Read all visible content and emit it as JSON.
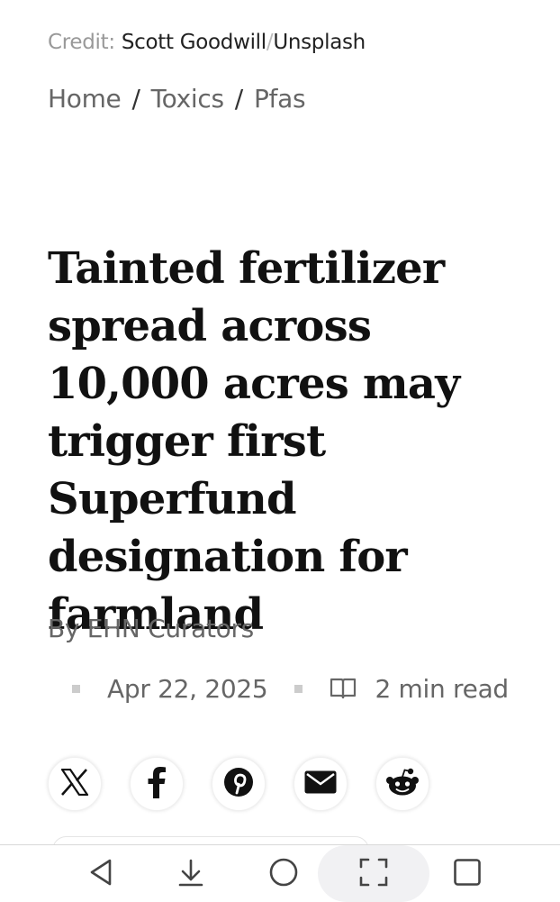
{
  "credit": {
    "label": "Credit:",
    "author": "Scott Goodwill",
    "separator": "/",
    "source": "Unsplash"
  },
  "breadcrumb": {
    "items": [
      "Home",
      "Toxics",
      "Pfas"
    ],
    "separator": "/"
  },
  "article": {
    "title": "Tainted fertilizer spread across 10,000 acres may trigger first Superfund designation for farmland",
    "byline": "By EHN Curators",
    "date": "Apr 22, 2025",
    "read_time": "2 min read"
  },
  "share": {
    "icons": [
      "x-icon",
      "facebook-icon",
      "pinterest-icon",
      "email-icon",
      "reddit-icon"
    ]
  },
  "system_nav": {
    "icons": [
      "back-icon",
      "download-icon",
      "home-icon",
      "screenshot-icon",
      "recents-icon"
    ]
  },
  "colors": {
    "text": "#111111",
    "muted": "#666666",
    "credit_label": "#999999",
    "divider": "#d8d8d8"
  }
}
